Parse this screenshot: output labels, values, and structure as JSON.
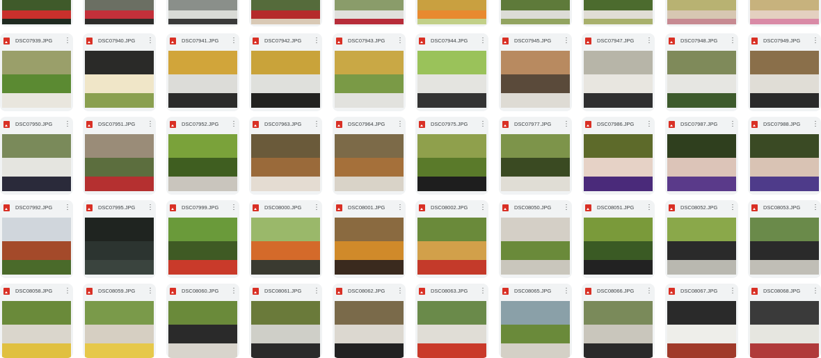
{
  "top_row_palettes": [
    [
      "#3f5a2a",
      "#c9302c",
      "#1f2a20"
    ],
    [
      "#6b6f63",
      "#c3303a",
      "#2d2c2a"
    ],
    [
      "#8a8f8a",
      "#d8dad6",
      "#3a3a3a"
    ],
    [
      "#556b3b",
      "#b52b2b",
      "#d9c9b5"
    ],
    [
      "#8a9c6a",
      "#e0e0dc",
      "#b72d3a"
    ],
    [
      "#c9a040",
      "#e88a30",
      "#c2d088"
    ],
    [
      "#5e7a3a",
      "#dcdcd6",
      "#92a460"
    ],
    [
      "#4c6b2e",
      "#e0ddd5",
      "#a8b06c"
    ],
    [
      "#b8b272",
      "#d7c7b2",
      "#c78a92"
    ],
    [
      "#c7b27d",
      "#e4d0c0",
      "#d98aa6"
    ]
  ],
  "rows": [
    {
      "files": [
        {
          "name": "DSC07939.JPG",
          "palette": [
            "#9a9f6a",
            "#5b8a32",
            "#e9e6de"
          ]
        },
        {
          "name": "DSC07940.JPG",
          "palette": [
            "#2a2a28",
            "#f0e6c8",
            "#8aa050"
          ]
        },
        {
          "name": "DSC07941.JPG",
          "palette": [
            "#d1a53a",
            "#dcdcd8",
            "#2b2b2a"
          ]
        },
        {
          "name": "DSC07942.JPG",
          "palette": [
            "#c9a33a",
            "#dfe0dc",
            "#222220"
          ]
        },
        {
          "name": "DSC07943.JPG",
          "palette": [
            "#c9a845",
            "#7a9a46",
            "#e2e2de"
          ]
        },
        {
          "name": "DSC07944.JPG",
          "palette": [
            "#9ac25a",
            "#e4e4e0",
            "#333"
          ]
        },
        {
          "name": "DSC07945.JPG",
          "palette": [
            "#b88a60",
            "#5a4a3a",
            "#dedbd4"
          ]
        },
        {
          "name": "DSC07947.JPG",
          "palette": [
            "#b7b5a8",
            "#e8e6e0",
            "#2f2f30"
          ]
        },
        {
          "name": "DSC07948.JPG",
          "palette": [
            "#7f8a5a",
            "#e6e6e2",
            "#3d5a2c"
          ]
        },
        {
          "name": "DSC07949.JPG",
          "palette": [
            "#8a6f4a",
            "#e0ddd6",
            "#2a2a2a"
          ]
        }
      ]
    },
    {
      "files": [
        {
          "name": "DSC07950.JPG",
          "palette": [
            "#7a8a5a",
            "#e5e5e0",
            "#2a2a3a"
          ]
        },
        {
          "name": "DSC07951.JPG",
          "palette": [
            "#9a8c78",
            "#5c6e3e",
            "#b53030"
          ]
        },
        {
          "name": "DSC07952.JPG",
          "palette": [
            "#7aa23a",
            "#3f5e20",
            "#c9c5bd"
          ]
        },
        {
          "name": "DSC07963.JPG",
          "palette": [
            "#6a5a3a",
            "#9a6a3a",
            "#e4dcd2"
          ]
        },
        {
          "name": "DSC07964.JPG",
          "palette": [
            "#7c6a48",
            "#a5703a",
            "#d9d3c8"
          ]
        },
        {
          "name": "DSC07975.JPG",
          "palette": [
            "#8fa04c",
            "#5a7a2a",
            "#1e1e1e"
          ]
        },
        {
          "name": "DSC07977.JPG",
          "palette": [
            "#7d944a",
            "#3a4a22",
            "#e0ddd5"
          ]
        },
        {
          "name": "DSC07986.JPG",
          "palette": [
            "#5d6a2a",
            "#e6d2c6",
            "#4a2a7a"
          ]
        },
        {
          "name": "DSC07987.JPG",
          "palette": [
            "#2f3f1e",
            "#dcc4b8",
            "#5a3a8a"
          ]
        },
        {
          "name": "DSC07988.JPG",
          "palette": [
            "#3a4a24",
            "#d9c3b4",
            "#4e3b8a"
          ]
        }
      ]
    },
    {
      "files": [
        {
          "name": "DSC07992.JPG",
          "palette": [
            "#d0d6dc",
            "#a44a2a",
            "#4a6a2a"
          ]
        },
        {
          "name": "DSC07995.JPG",
          "palette": [
            "#1f2420",
            "#2c3430",
            "#3a443e"
          ]
        },
        {
          "name": "DSC07999.JPG",
          "palette": [
            "#6a9a3a",
            "#3f5a24",
            "#c93a2a"
          ]
        },
        {
          "name": "DSC08000.JPG",
          "palette": [
            "#9ab86a",
            "#d46a2a",
            "#3a3a30"
          ]
        },
        {
          "name": "DSC08001.JPG",
          "palette": [
            "#8a6a40",
            "#d08a2a",
            "#3a2a1e"
          ]
        },
        {
          "name": "DSC08002.JPG",
          "palette": [
            "#6a8a3a",
            "#d2a04a",
            "#c43a2a"
          ]
        },
        {
          "name": "DSC08050.JPG",
          "palette": [
            "#d4cfc6",
            "#6a8a3a",
            "#c9c6bc"
          ]
        },
        {
          "name": "DSC08051.JPG",
          "palette": [
            "#7a9a3a",
            "#3a5a24",
            "#222"
          ]
        },
        {
          "name": "DSC08052.JPG",
          "palette": [
            "#8aa84a",
            "#2a2a2a",
            "#b9b8b0"
          ]
        },
        {
          "name": "DSC08053.JPG",
          "palette": [
            "#6a8a4a",
            "#2a2a2a",
            "#c0beb6"
          ]
        }
      ]
    },
    {
      "files": [
        {
          "name": "DSC08058.JPG",
          "palette": [
            "#6a8a3a",
            "#dad6cc",
            "#e0c040"
          ]
        },
        {
          "name": "DSC08059.JPG",
          "palette": [
            "#7a9a4a",
            "#d6cfc2",
            "#e6c84a"
          ]
        },
        {
          "name": "DSC08060.JPG",
          "palette": [
            "#6a8a3a",
            "#2a2a2a",
            "#d8d4cc"
          ]
        },
        {
          "name": "DSC08061.JPG",
          "palette": [
            "#6a7a3a",
            "#cfcfc8",
            "#2a2a2a"
          ]
        },
        {
          "name": "DSC08062.JPG",
          "palette": [
            "#7a6a4a",
            "#dcd8d0",
            "#222"
          ]
        },
        {
          "name": "DSC08063.JPG",
          "palette": [
            "#6a8a4a",
            "#e0ddd6",
            "#c93a2a"
          ]
        },
        {
          "name": "DSC08065.JPG",
          "palette": [
            "#8aa0a8",
            "#6a8a3a",
            "#d4d0c6"
          ]
        },
        {
          "name": "DSC08066.JPG",
          "palette": [
            "#7a8a5a",
            "#c9c6bc",
            "#2a2a2a"
          ]
        },
        {
          "name": "DSC08067.JPG",
          "palette": [
            "#2a2a2a",
            "#eeeeea",
            "#a03a2a"
          ]
        },
        {
          "name": "DSC08068.JPG",
          "palette": [
            "#3a3a3a",
            "#e6e6e0",
            "#b03a3a"
          ]
        }
      ]
    }
  ]
}
